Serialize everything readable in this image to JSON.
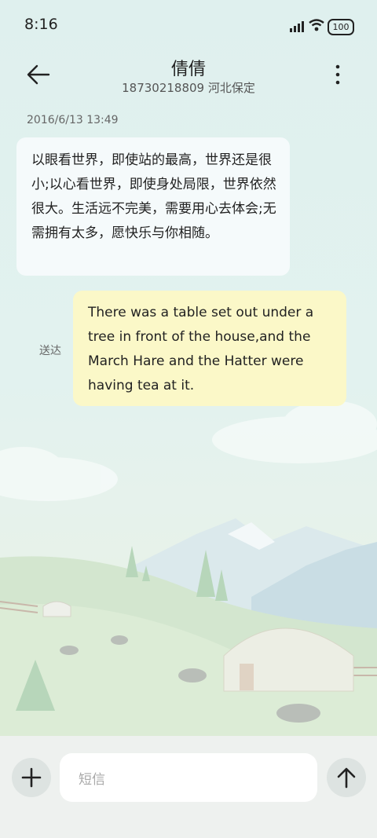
{
  "status_bar": {
    "time": "8:16",
    "battery": "100"
  },
  "header": {
    "title": "倩倩",
    "subtitle": "18730218809 河北保定"
  },
  "conversation": {
    "date": "2016/6/13 13:49",
    "incoming_text": "以眼看世界，即使站的最高，世界还是很小;以心看世界，即使身处局限，世界依然很大。生活远不完美，需要用心去体会;无需拥有太多，愿快乐与你相随。",
    "outgoing_text": "There was a table set out under a tree in front of the house,and the March Hare and the Hatter were having tea at it.",
    "outgoing_status": "送达"
  },
  "composer": {
    "placeholder": "短信"
  },
  "colors": {
    "incoming_bubble": "#f5fafb",
    "outgoing_bubble": "#fbf8c8",
    "background": "#dff0ee"
  },
  "icons": [
    "back-arrow-icon",
    "more-vertical-icon",
    "plus-icon",
    "send-arrow-icon",
    "signal-icon",
    "wifi-icon",
    "battery-icon"
  ]
}
